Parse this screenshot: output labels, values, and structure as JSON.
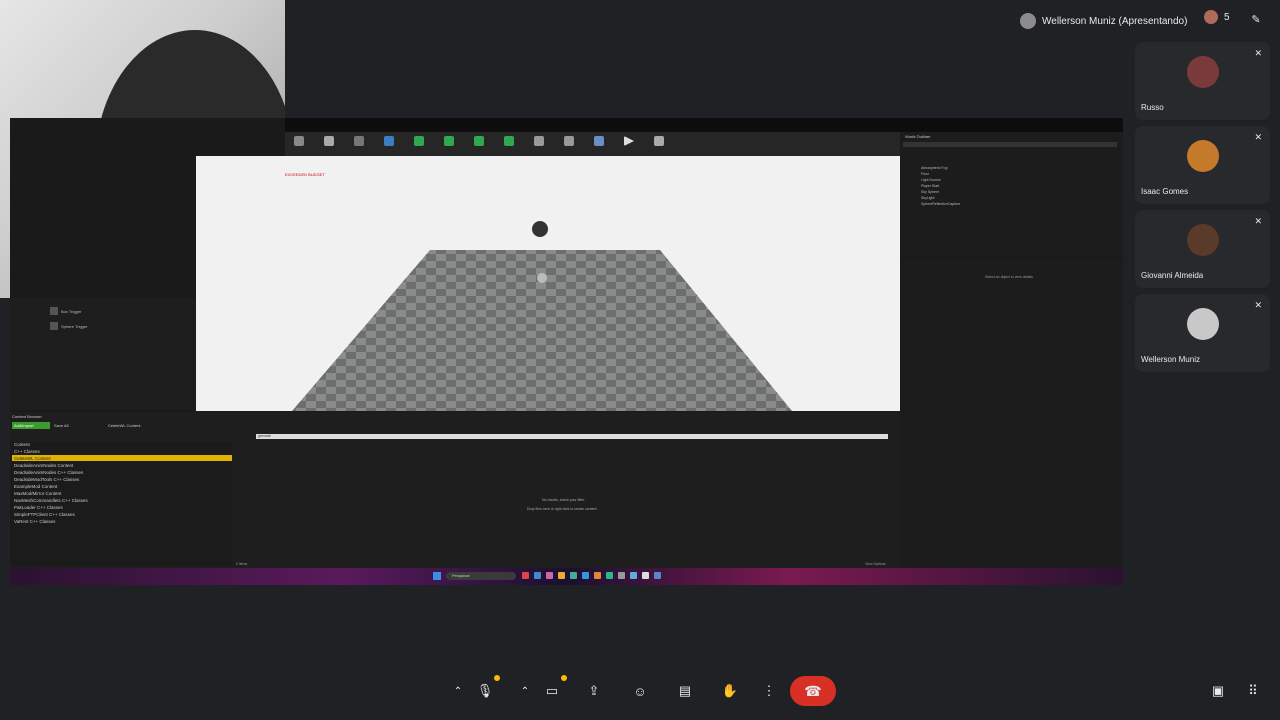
{
  "presenter": {
    "label": "Wellerson Muniz (Apresentando)"
  },
  "participants_count": "5",
  "participants": [
    {
      "name": "Russo",
      "color": "#7a3a3a"
    },
    {
      "name": "Isaac Gomes",
      "color": "#c47a2a"
    },
    {
      "name": "Giovanni Almeida",
      "color": "#5a3a2a"
    },
    {
      "name": "Wellerson Muniz",
      "color": "#c8c8c8"
    }
  ],
  "editor": {
    "budget_text": "EXCEEDED BUDGET",
    "left_panel_items": [
      "Box Trigger",
      "Sphere Trigger"
    ],
    "outliner_title": "World Outliner",
    "outliner_items": [
      "Atmospheric Fog",
      "Floor",
      "Light Source",
      "Player Start",
      "Sky Sphere",
      "SkyLight",
      "SphereReflectionCapture"
    ],
    "details_text": "Select an object to view details.",
    "cb_tab": "Content Browser",
    "cb_add": "Add/Import",
    "cb_save": "Save All",
    "cb_path": "CeleteWL Content",
    "cb_search": "grenade",
    "cb_tree": [
      "Content",
      "C++ Classes",
      "CeleteWL Content",
      "DeadsideAnimNodes Content",
      "DeadsideAnimNodes C++ Classes",
      "DeadsideModTools C++ Classes",
      "ExampleMod Content",
      "MaxMod/Mirror Content",
      "NavMeshCommandlets C++ Classes",
      "PakLoader C++ Classes",
      "SimpleFTPClient C++ Classes",
      "VaRest C++ Classes"
    ],
    "cb_empty_1": "No results, check your filter.",
    "cb_empty_2": "Drop files here or right click to create content.",
    "cb_items": "0 items",
    "view_options": "View Options",
    "taskbar_search": "Pesquisar"
  },
  "controls": {
    "mic_icon": "mic-icon",
    "camera_icon": "camera-icon",
    "present_icon": "present-icon",
    "emoji_icon": "emoji-icon",
    "captions_icon": "captions-icon",
    "hand_icon": "hand-icon",
    "more_icon": "more-icon",
    "end_call_icon": "end-call-icon",
    "chat_icon": "chat-icon",
    "activities_icon": "apps-icon"
  },
  "colors": {
    "end_call": "#d93025",
    "badge": "#fbbc04",
    "selected_folder": "#e0b400"
  }
}
